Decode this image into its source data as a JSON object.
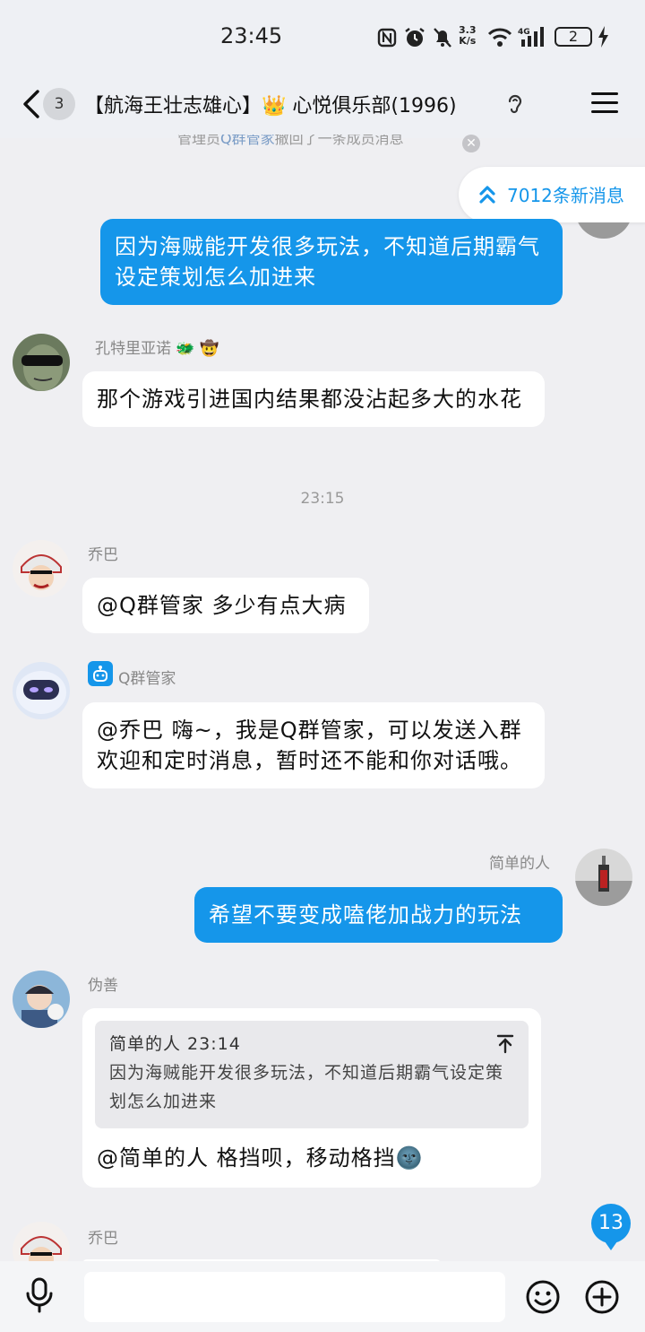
{
  "status_bar": {
    "time": "23:45",
    "speed_top": "3.3",
    "speed_bottom": "K/s",
    "network": "4G",
    "battery": "2"
  },
  "header": {
    "back_count": "3",
    "title": "【航海王壮志雄心】👑 心悦俱乐部(1996)"
  },
  "recall_notice": {
    "prefix": "管理员",
    "highlight": "Q群管家",
    "suffix": "撤回了一条成员消息"
  },
  "new_messages": {
    "label": "7012条新消息"
  },
  "messages": [
    {
      "text": "因为海贼能开发很多玩法，不知道后期霸气设定策划怎么加进来"
    },
    {
      "sender": "孔特里亚诺 🐲 🤠",
      "text": "那个游戏引进国内结果都没沾起多大的水花"
    },
    {
      "time": "23:15"
    },
    {
      "sender": "乔巴",
      "text": "@Q群管家 多少有点大病"
    },
    {
      "sender": "Q群管家",
      "text": "@乔巴 嗨~，我是Q群管家，可以发送入群欢迎和定时消息，暂时还不能和你对话哦。"
    },
    {
      "sender": "简单的人",
      "text": "希望不要变成嗑佬加战力的玩法"
    },
    {
      "sender": "伪善",
      "quote_head": "简单的人 23:14",
      "quote_body": "因为海贼能开发很多玩法，不知道后期霸气设定策划怎么加进来",
      "text": "@简单的人 格挡呗，移动格挡🌚"
    },
    {
      "sender": "乔巴"
    }
  ],
  "unread_count": "13",
  "colors": {
    "accent": "#1596ea",
    "background": "#efeff2",
    "bubble_in": "#ffffff"
  }
}
